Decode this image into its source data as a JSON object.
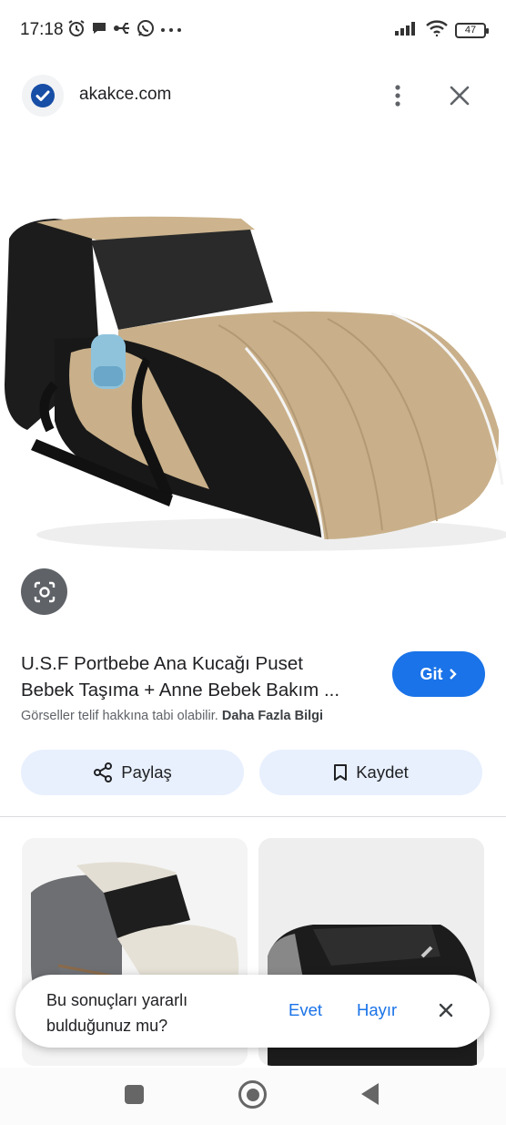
{
  "status_bar": {
    "time": "17:18",
    "battery": "47",
    "left_icons": [
      "alarm-icon",
      "chat-bubble-icon",
      "usb-icon",
      "whatsapp-icon",
      "more-dots-icon"
    ],
    "right_icons": [
      "signal-icon",
      "wifi-icon",
      "battery-icon"
    ]
  },
  "header": {
    "site": "akakce.com",
    "badge_icon": "verified-check-icon",
    "menu_icon": "more-vert-icon",
    "close_icon": "close-icon"
  },
  "main_image": {
    "icon": "product-image"
  },
  "result": {
    "title_line1": "U.S.F Portbebe Ana Kucağı Puset",
    "title_line2": "Bebek Taşıma + Anne Bebek Bakım ...",
    "notice": "Görseller telif hakkına tabi olabilir.",
    "more_info": "Daha Fazla Bilgi",
    "visit_label": "Git"
  },
  "actions": {
    "share_label": "Paylaş",
    "save_label": "Kaydet"
  },
  "feedback": {
    "question_line1": "Bu sonuçları yararlı",
    "question_line2": "bulduğunuz mu?",
    "yes_label": "Evet",
    "no_label": "Hayır"
  },
  "colors": {
    "accent": "#1a73e8",
    "chip_bg": "#e8f0fe",
    "text": "#202124",
    "muted": "#5f6368"
  }
}
